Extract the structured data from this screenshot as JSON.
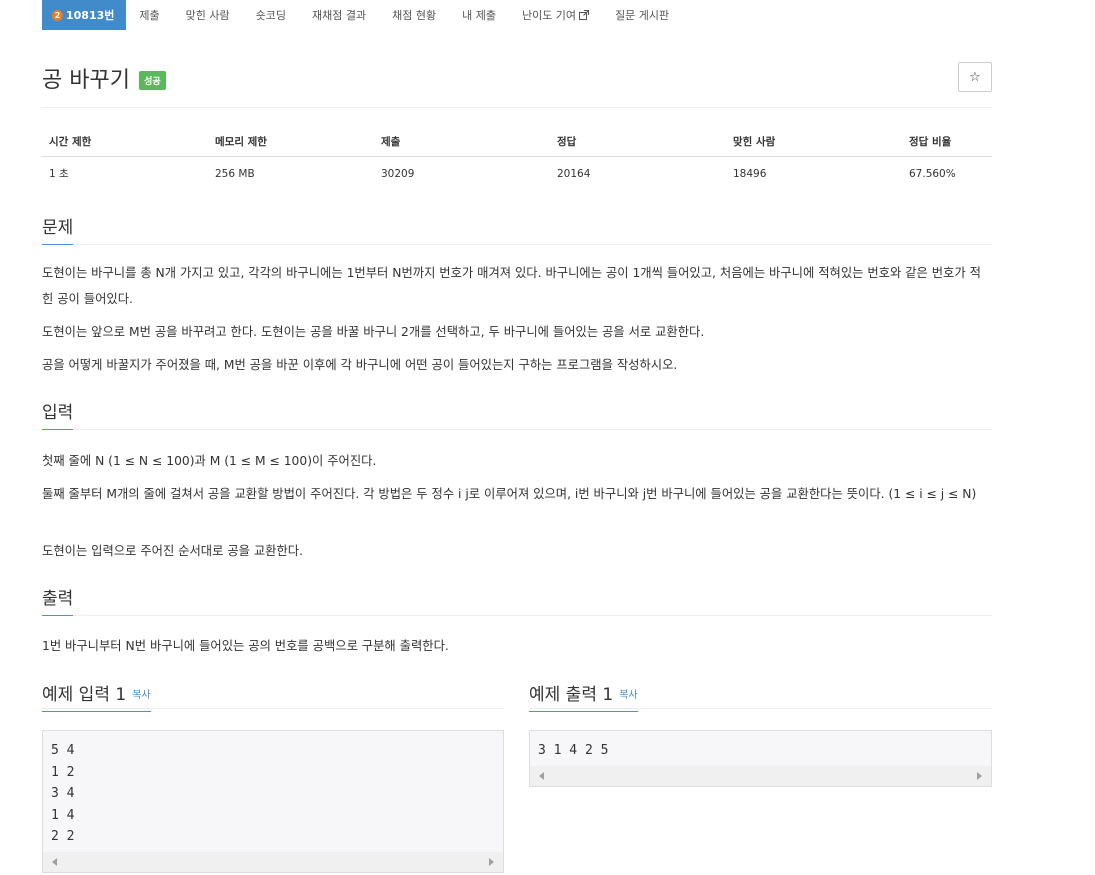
{
  "nav": {
    "problem_number": "10813번",
    "tier_icon": "2",
    "items": [
      "제출",
      "맞힌 사람",
      "숏코딩",
      "재채점 결과",
      "채점 현황",
      "내 제출",
      "난이도 기여",
      "질문 게시판"
    ]
  },
  "title": "공 바꾸기",
  "badge": "성공",
  "star_icon": "☆",
  "info": {
    "headers": [
      "시간 제한",
      "메모리 제한",
      "제출",
      "정답",
      "맞힌 사람",
      "정답 비율"
    ],
    "values": [
      "1 초",
      "256 MB",
      "30209",
      "20164",
      "18496",
      "67.560%"
    ]
  },
  "sections": {
    "problem": {
      "title": "문제",
      "p1": "도현이는 바구니를 총 N개 가지고 있고, 각각의 바구니에는 1번부터 N번까지 번호가 매겨져 있다. 바구니에는 공이 1개씩 들어있고, 처음에는 바구니에 적혀있는 번호와 같은 번호가 적힌 공이 들어있다.",
      "p2": "도현이는 앞으로 M번 공을 바꾸려고 한다. 도현이는 공을 바꿀 바구니 2개를 선택하고, 두 바구니에 들어있는 공을 서로 교환한다.",
      "p3": "공을 어떻게 바꿀지가 주어졌을 때, M번 공을 바꾼 이후에 각 바구니에 어떤 공이 들어있는지 구하는 프로그램을 작성하시오."
    },
    "input": {
      "title": "입력",
      "p1": "첫째 줄에 N (1 ≤ N ≤ 100)과 M (1 ≤ M ≤ 100)이 주어진다.",
      "p2": "둘째 줄부터 M개의 줄에 걸쳐서 공을 교환할 방법이 주어진다. 각 방법은 두 정수 i j로 이루어져 있으며, i번 바구니와 j번 바구니에 들어있는 공을 교환한다는 뜻이다. (1 ≤ i ≤ j ≤ N)",
      "p3": "도현이는 입력으로 주어진 순서대로 공을 교환한다."
    },
    "output": {
      "title": "출력",
      "p1": "1번 바구니부터 N번 바구니에 들어있는 공의 번호를 공백으로 구분해 출력한다."
    }
  },
  "samples": {
    "input_title": "예제 입력 1",
    "output_title": "예제 출력 1",
    "copy_label": "복사",
    "input_lines": "5 4\n1 2\n3 4\n1 4\n2 2",
    "output_lines": "3 1 4 2 5"
  },
  "colors": {
    "accent": "#428bca",
    "success": "#5cb85c",
    "tier": "#e87d28"
  }
}
